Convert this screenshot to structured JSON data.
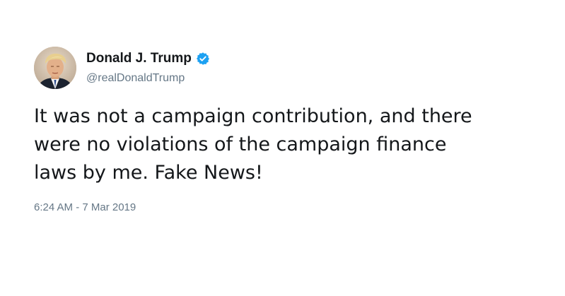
{
  "author": {
    "display_name": "Donald J. Trump",
    "handle": "@realDonaldTrump",
    "verified": true,
    "avatar_icon": "profile-photo"
  },
  "tweet": {
    "lines": [
      "It was not a campaign contribution, and there",
      "were no violations of the campaign finance",
      "laws by me. Fake News!"
    ],
    "timestamp": "6:24 AM - 7 Mar 2019"
  },
  "colors": {
    "text": "#14171a",
    "secondary": "#657786",
    "verified_badge": "#1da1f2",
    "background": "#ffffff"
  }
}
